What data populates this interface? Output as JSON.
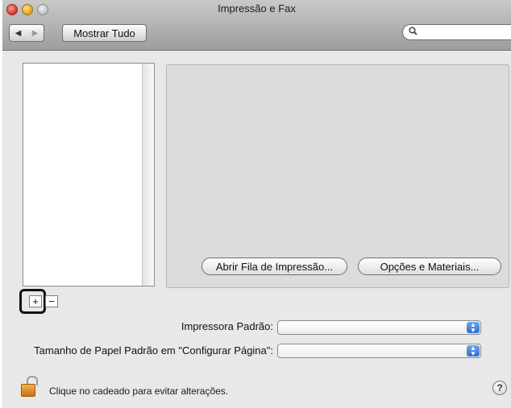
{
  "window": {
    "title": "Impressão e Fax"
  },
  "toolbar": {
    "back_icon": "◀",
    "forward_icon": "▶",
    "show_all_label": "Mostrar Tudo",
    "search_icon": "magnifier-icon",
    "search_glyph": "🔍",
    "search_value": ""
  },
  "printer_list": {
    "add_label": "+",
    "remove_label": "−"
  },
  "detail": {
    "open_queue_label": "Abrir Fila de Impressão...",
    "options_label": "Opções e Materiais..."
  },
  "form": {
    "default_printer_label": "Impressora Padrão:",
    "default_printer_value": "",
    "default_paper_label": "Tamanho de Papel Padrão em \"Configurar Página\":",
    "default_paper_value": ""
  },
  "footer": {
    "lock_message": "Clique no cadeado para evitar alterações.",
    "help_label": "?"
  },
  "colors": {
    "popup_arrow": "#2c6fd1",
    "lock_body": "#e39a2e",
    "highlight": "#111111"
  }
}
